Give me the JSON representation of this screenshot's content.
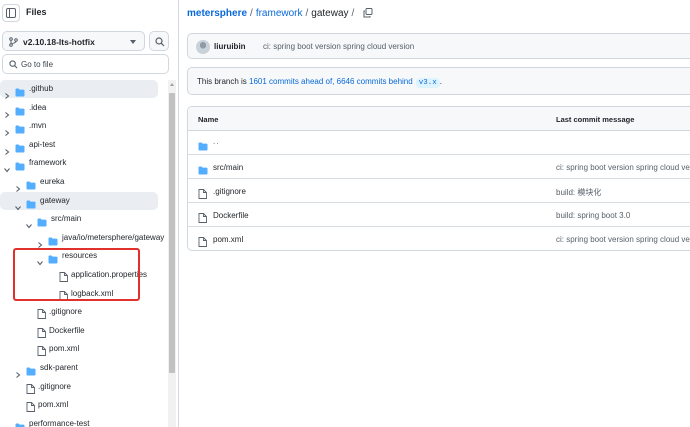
{
  "sidebar": {
    "title": "Files",
    "branch": "v2.10.18-lts-hotfix",
    "search_placeholder": "Go to file",
    "tree": [
      {
        "label": ".github",
        "kind": "folder",
        "depth": 0,
        "expanded": false,
        "active": true
      },
      {
        "label": ".idea",
        "kind": "folder",
        "depth": 0,
        "expanded": false
      },
      {
        "label": ".mvn",
        "kind": "folder",
        "depth": 0,
        "expanded": false
      },
      {
        "label": "api-test",
        "kind": "folder",
        "depth": 0,
        "expanded": false
      },
      {
        "label": "framework",
        "kind": "folder",
        "depth": 0,
        "expanded": true
      },
      {
        "label": "eureka",
        "kind": "folder",
        "depth": 1,
        "expanded": false
      },
      {
        "label": "gateway",
        "kind": "folder",
        "depth": 1,
        "expanded": true,
        "active": true
      },
      {
        "label": "src/main",
        "kind": "folder",
        "depth": 2,
        "expanded": true
      },
      {
        "label": "java/io/metersphere/gateway",
        "kind": "folder",
        "depth": 3,
        "expanded": false
      },
      {
        "label": "resources",
        "kind": "folder",
        "depth": 3,
        "expanded": true
      },
      {
        "label": "application.properties",
        "kind": "file",
        "depth": 4
      },
      {
        "label": "logback.xml",
        "kind": "file",
        "depth": 4
      },
      {
        "label": ".gitignore",
        "kind": "file",
        "depth": 2
      },
      {
        "label": "Dockerfile",
        "kind": "file",
        "depth": 2
      },
      {
        "label": "pom.xml",
        "kind": "file",
        "depth": 2
      },
      {
        "label": "sdk-parent",
        "kind": "folder",
        "depth": 1,
        "expanded": false
      },
      {
        "label": ".gitignore",
        "kind": "file",
        "depth": 1
      },
      {
        "label": "pom.xml",
        "kind": "file",
        "depth": 1
      },
      {
        "label": "performance-test",
        "kind": "folder",
        "depth": 0,
        "expanded": false
      }
    ]
  },
  "breadcrumb": {
    "root": "metersphere",
    "parts": [
      "framework",
      "gateway"
    ],
    "sep": "/"
  },
  "commit": {
    "author": "liuruibin",
    "message": "ci: spring boot version spring cloud version"
  },
  "branch_status": {
    "prefix": "This branch is",
    "ahead": "1601 commits ahead of,",
    "behind": "6646 commits behind",
    "base": "v3.x",
    "suffix": "."
  },
  "table": {
    "col_name": "Name",
    "col_msg": "Last commit message",
    "rows": [
      {
        "name": "..",
        "kind": "parent",
        "message": ""
      },
      {
        "name": "src/main",
        "kind": "folder",
        "message": "ci: spring boot version spring cloud ve"
      },
      {
        "name": ".gitignore",
        "kind": "file",
        "message": "build: 模块化"
      },
      {
        "name": "Dockerfile",
        "kind": "file",
        "message": "build: spring boot 3.0"
      },
      {
        "name": "pom.xml",
        "kind": "file",
        "message": "ci: spring boot version spring cloud ve"
      }
    ]
  },
  "colors": {
    "link": "#0969da",
    "folder": "#54aeff",
    "highlight": "#e0312d"
  },
  "icons": {
    "panel": "sidebar-panel-icon",
    "branch": "git-branch-icon",
    "search": "search-icon",
    "copy": "copy-icon",
    "folder": "folder-icon",
    "file": "file-icon"
  }
}
